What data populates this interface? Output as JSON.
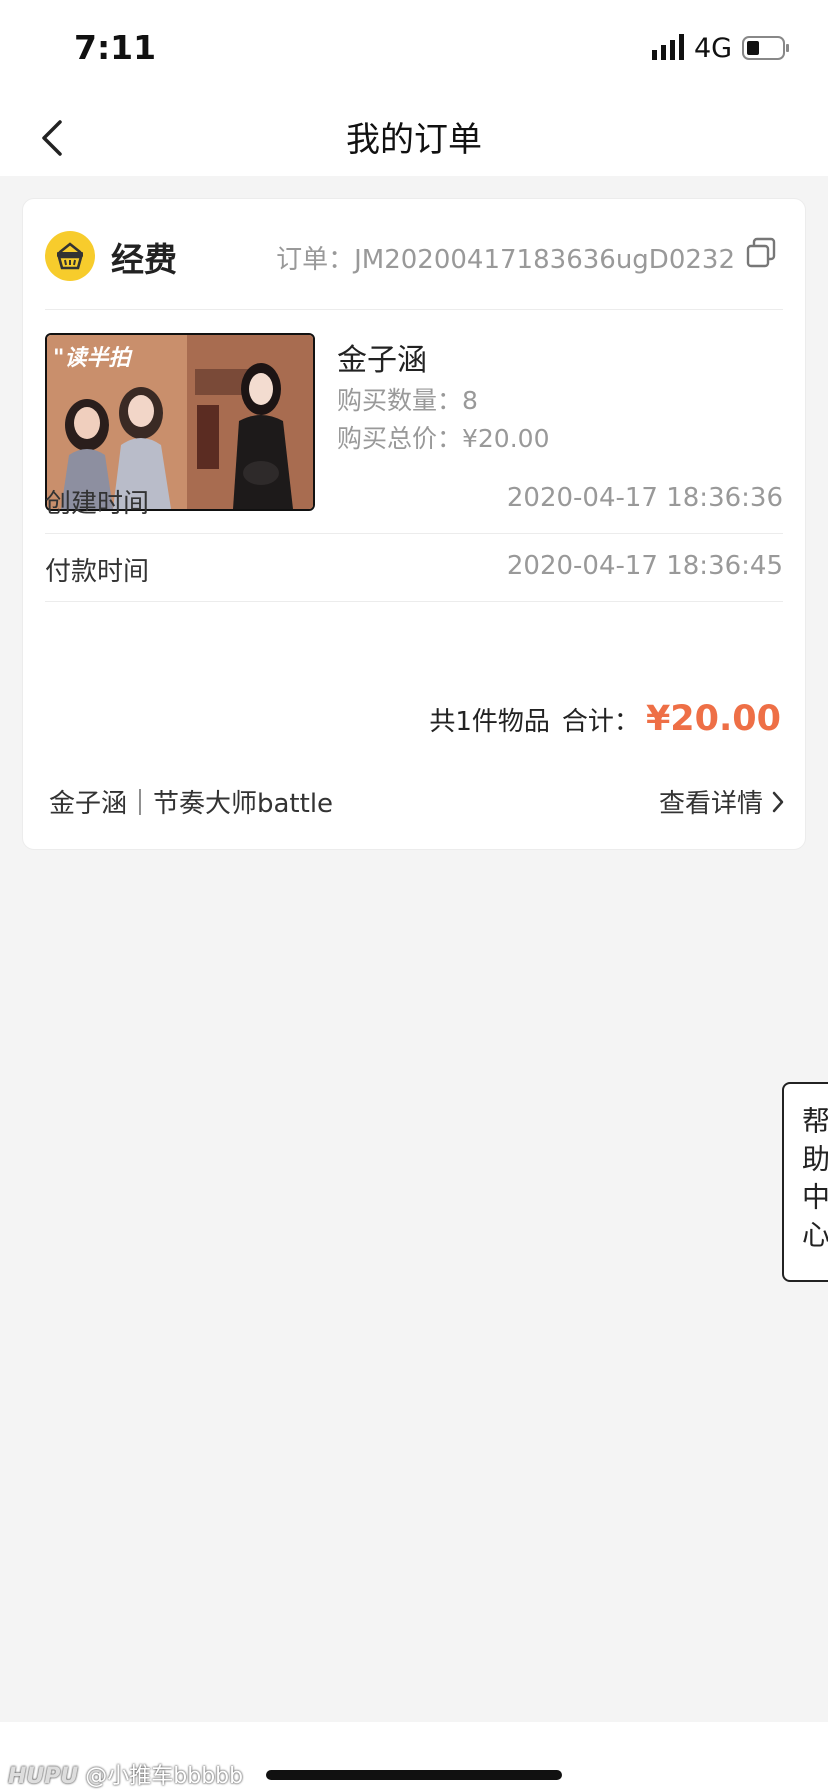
{
  "status_bar": {
    "time": "7:11",
    "network": "4G"
  },
  "header": {
    "title": "我的订单"
  },
  "order": {
    "category": "经费",
    "order_number": "订单：JM20200417183636ugD0232",
    "product_name": "金子涵",
    "quantity": "购买数量：8",
    "total_price": "购买总价：¥20.00",
    "thumbnail_icon": "product-poster-image",
    "created_label": "创建时间",
    "created_value": "2020-04-17 18:36:36",
    "paid_label": "付款时间",
    "paid_value": "2020-04-17 18:36:45",
    "item_count": "共1件物品",
    "sum_label": "合计：",
    "sum_amount": "¥20.00",
    "event_name": "金子涵｜节奏大师battle",
    "detail_link": "查看详情"
  },
  "help": {
    "label": "帮助中心"
  },
  "watermark": {
    "brand": "HUPU",
    "user": "@小推车bbbbb"
  },
  "colors": {
    "accent": "#ee6f46",
    "category_icon": "#f7cc2c",
    "background": "#f4f4f4"
  }
}
